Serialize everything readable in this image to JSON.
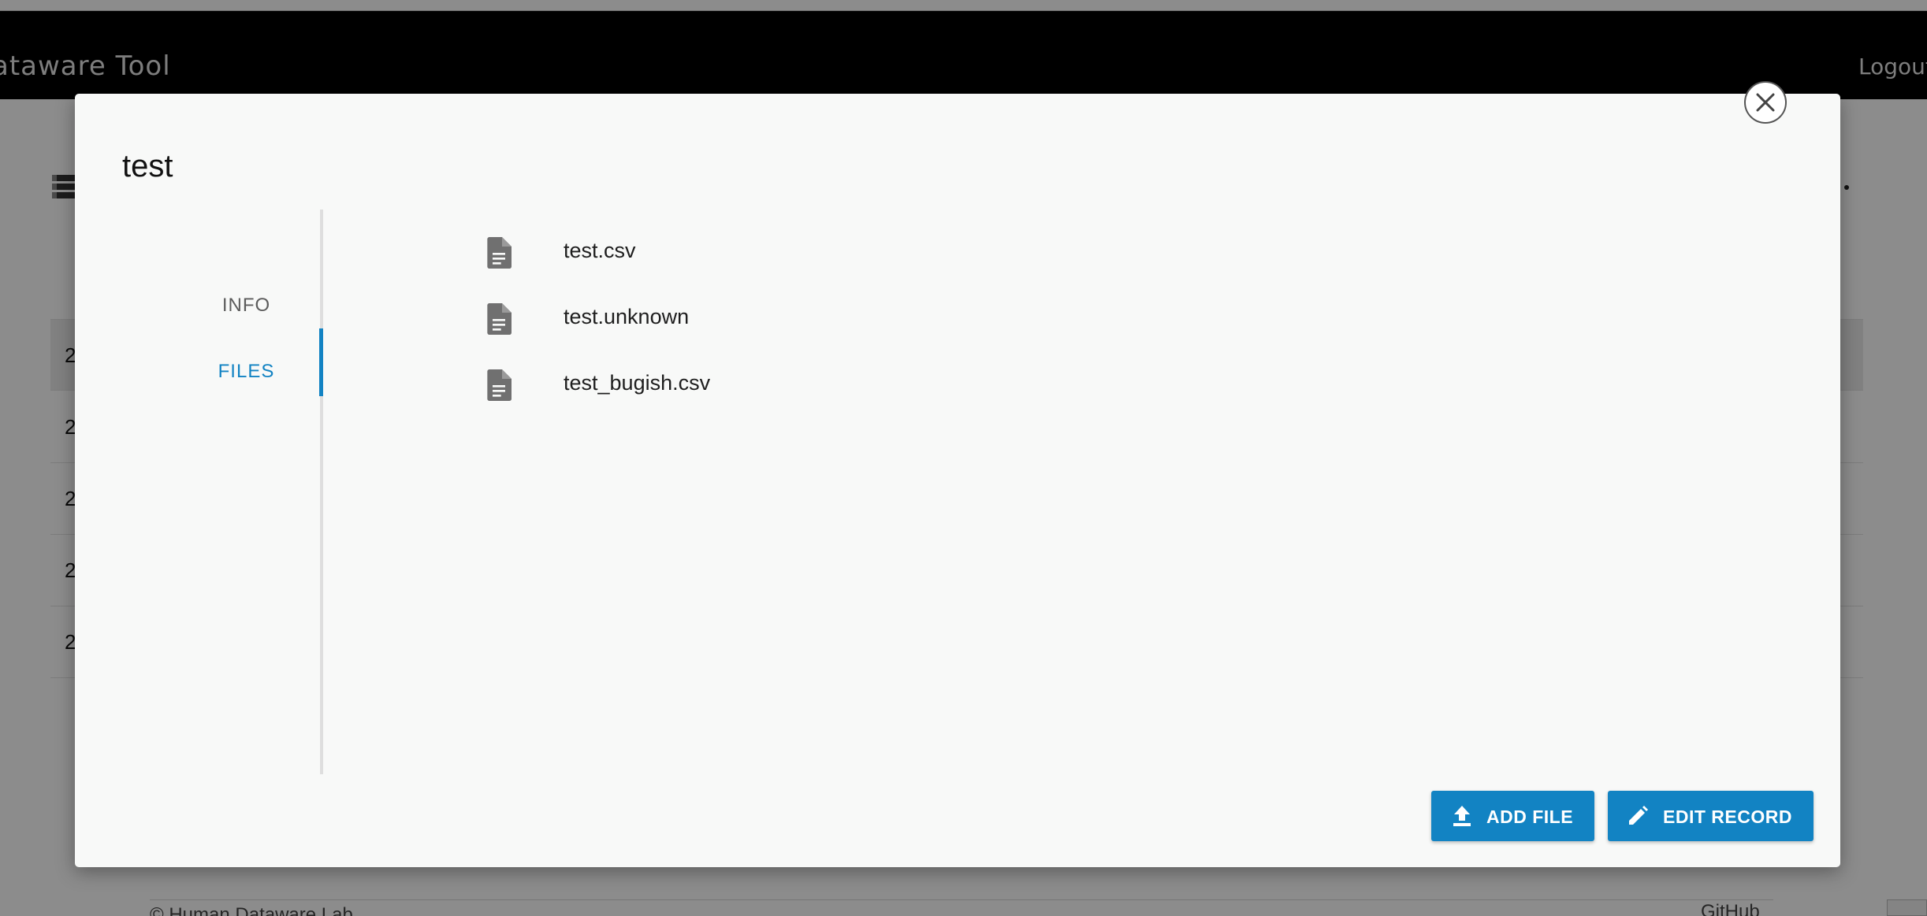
{
  "app": {
    "title": "ataware Tool",
    "logout_label": "Logout"
  },
  "background": {
    "rows": [
      "2",
      "2",
      "2",
      "2",
      "2"
    ],
    "footer_left": "© Human Dataware Lab",
    "footer_right": "GitHub"
  },
  "modal": {
    "title": "test",
    "tabs": [
      {
        "label": "INFO",
        "active": false
      },
      {
        "label": "FILES",
        "active": true
      }
    ],
    "files": [
      {
        "name": "test.csv",
        "icon": "file-document-icon"
      },
      {
        "name": "test.unknown",
        "icon": "file-document-icon"
      },
      {
        "name": "test_bugish.csv",
        "icon": "file-document-icon"
      }
    ],
    "buttons": {
      "add_file": "ADD FILE",
      "edit_record": "EDIT RECORD"
    }
  },
  "colors": {
    "accent": "#1283c3",
    "appbar": "#000000",
    "modal_bg": "#f8f9f8"
  }
}
